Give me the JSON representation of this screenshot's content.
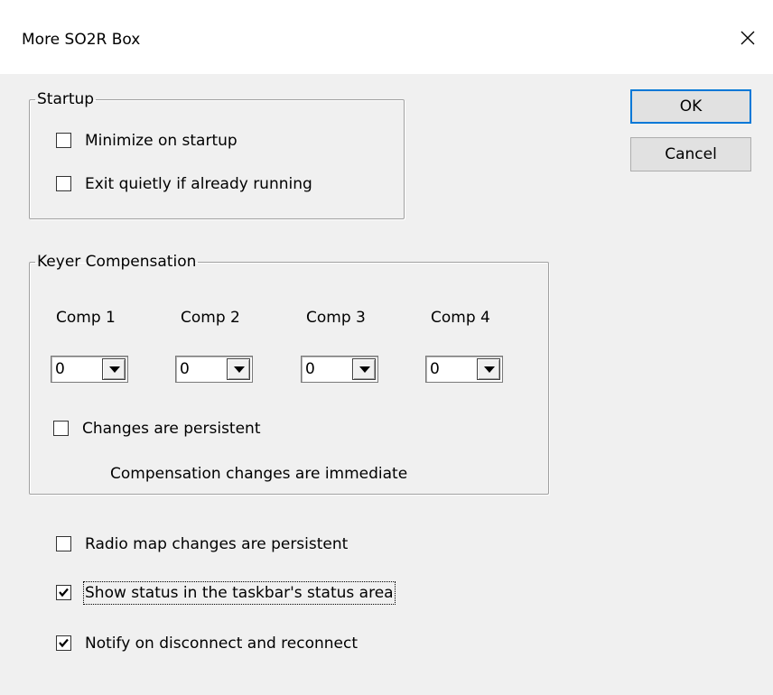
{
  "window": {
    "title": "More SO2R Box"
  },
  "buttons": {
    "ok": "OK",
    "cancel": "Cancel"
  },
  "startup": {
    "group_label": "Startup",
    "minimize": {
      "label": "Minimize on startup",
      "checked": false
    },
    "exit_quietly": {
      "label": "Exit quietly if already running",
      "checked": false
    }
  },
  "keyer": {
    "group_label": "Keyer Compensation",
    "comps": [
      {
        "label": "Comp 1",
        "value": "0"
      },
      {
        "label": "Comp 2",
        "value": "0"
      },
      {
        "label": "Comp 3",
        "value": "0"
      },
      {
        "label": "Comp 4",
        "value": "0"
      }
    ],
    "persistent": {
      "label": "Changes are persistent",
      "checked": false
    },
    "note": "Compensation changes are immediate"
  },
  "options": {
    "radio_map": {
      "label": "Radio map changes are persistent",
      "checked": false
    },
    "show_status": {
      "label": "Show status in the taskbar's status area",
      "checked": true
    },
    "notify": {
      "label": "Notify on disconnect and reconnect",
      "checked": true
    }
  },
  "icons": {
    "close": "close-icon",
    "checkmark": "checkmark-icon",
    "dropdown": "chevron-down-icon"
  }
}
